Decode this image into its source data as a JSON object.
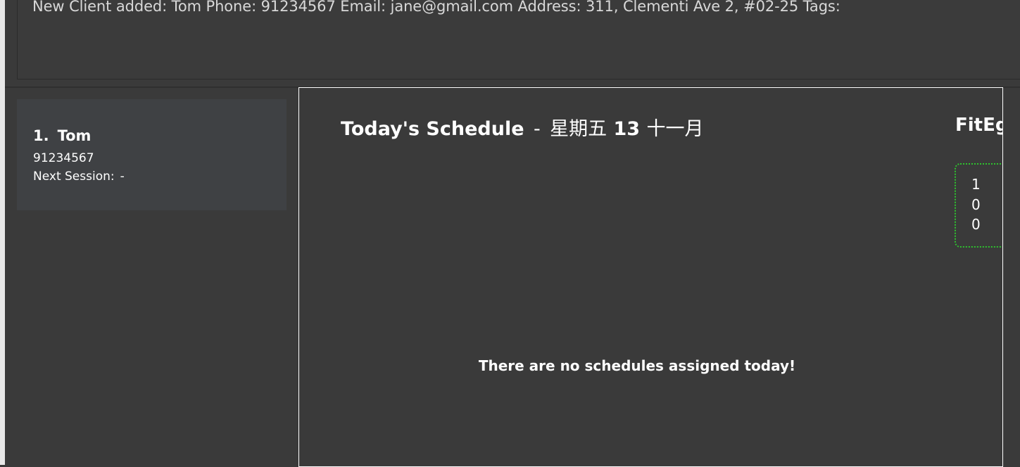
{
  "result": {
    "message": "New Client added: Tom Phone: 91234567 Email: jane@gmail.com Address: 311, Clementi Ave 2, #02-25 Tags:"
  },
  "clients": [
    {
      "index": "1.",
      "name": "Tom",
      "phone": "91234567",
      "next_session_label": "Next Session:",
      "next_session_value": "-"
    }
  ],
  "schedule": {
    "title": "Today's Schedule",
    "separator": "-",
    "day": "星期五",
    "date_num": "13",
    "month": "十一月",
    "empty_message": "There are no schedules assigned today!"
  },
  "fitness": {
    "title": "FitEg",
    "values": [
      "1",
      "0",
      "0"
    ],
    "accent_color": "#2ec22e"
  }
}
